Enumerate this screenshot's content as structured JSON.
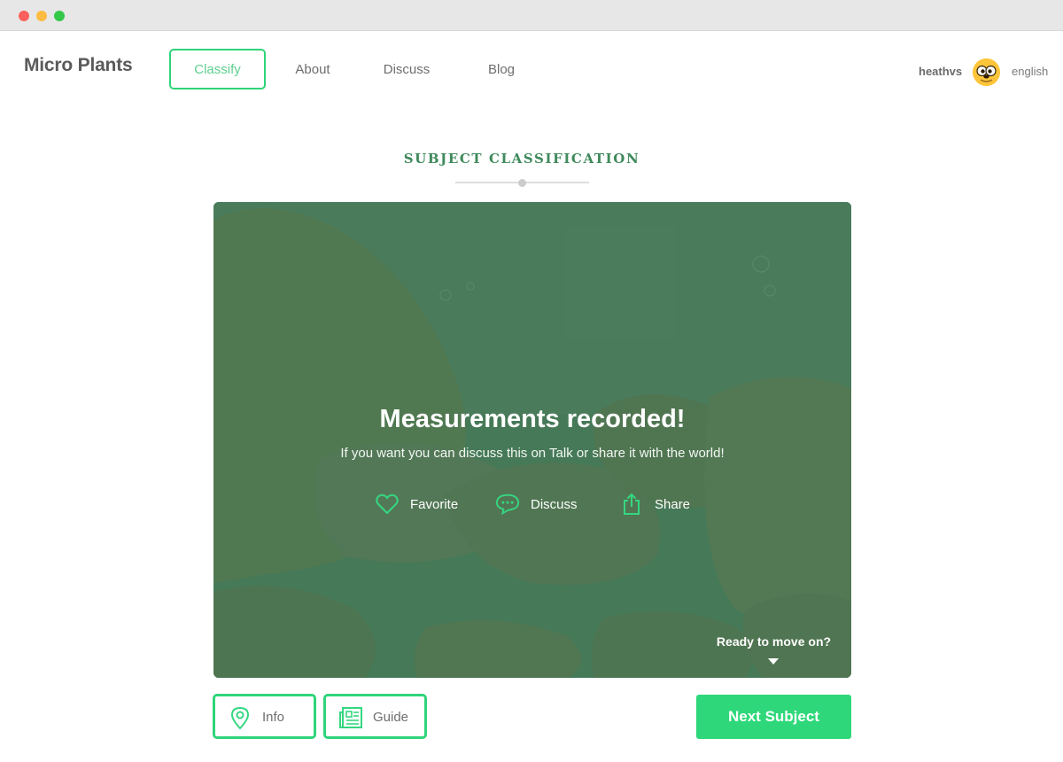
{
  "app": {
    "brand": "Micro Plants"
  },
  "nav": {
    "items": [
      {
        "label": "Classify",
        "active": true
      },
      {
        "label": "About",
        "active": false
      },
      {
        "label": "Discuss",
        "active": false
      },
      {
        "label": "Blog",
        "active": false
      }
    ]
  },
  "user": {
    "username": "heathvs",
    "language": "english",
    "avatar_icon": "cartoon-dog-face-icon"
  },
  "section": {
    "title": "SUBJECT CLASSIFICATION"
  },
  "subject": {
    "message_title": "Measurements recorded!",
    "message_subtitle": "If you want you can discuss this on Talk or share it with the world!",
    "actions": [
      {
        "label": "Favorite",
        "icon": "heart-icon"
      },
      {
        "label": "Discuss",
        "icon": "speech-bubble-icon"
      },
      {
        "label": "Share",
        "icon": "share-icon"
      }
    ],
    "move_on_label": "Ready to move on?"
  },
  "footer": {
    "info_label": "Info",
    "guide_label": "Guide",
    "next_label": "Next Subject"
  },
  "colors": {
    "accent": "#2ed87a",
    "title_green": "#3f8a5c",
    "overlay_green": "#4f7d5e"
  }
}
